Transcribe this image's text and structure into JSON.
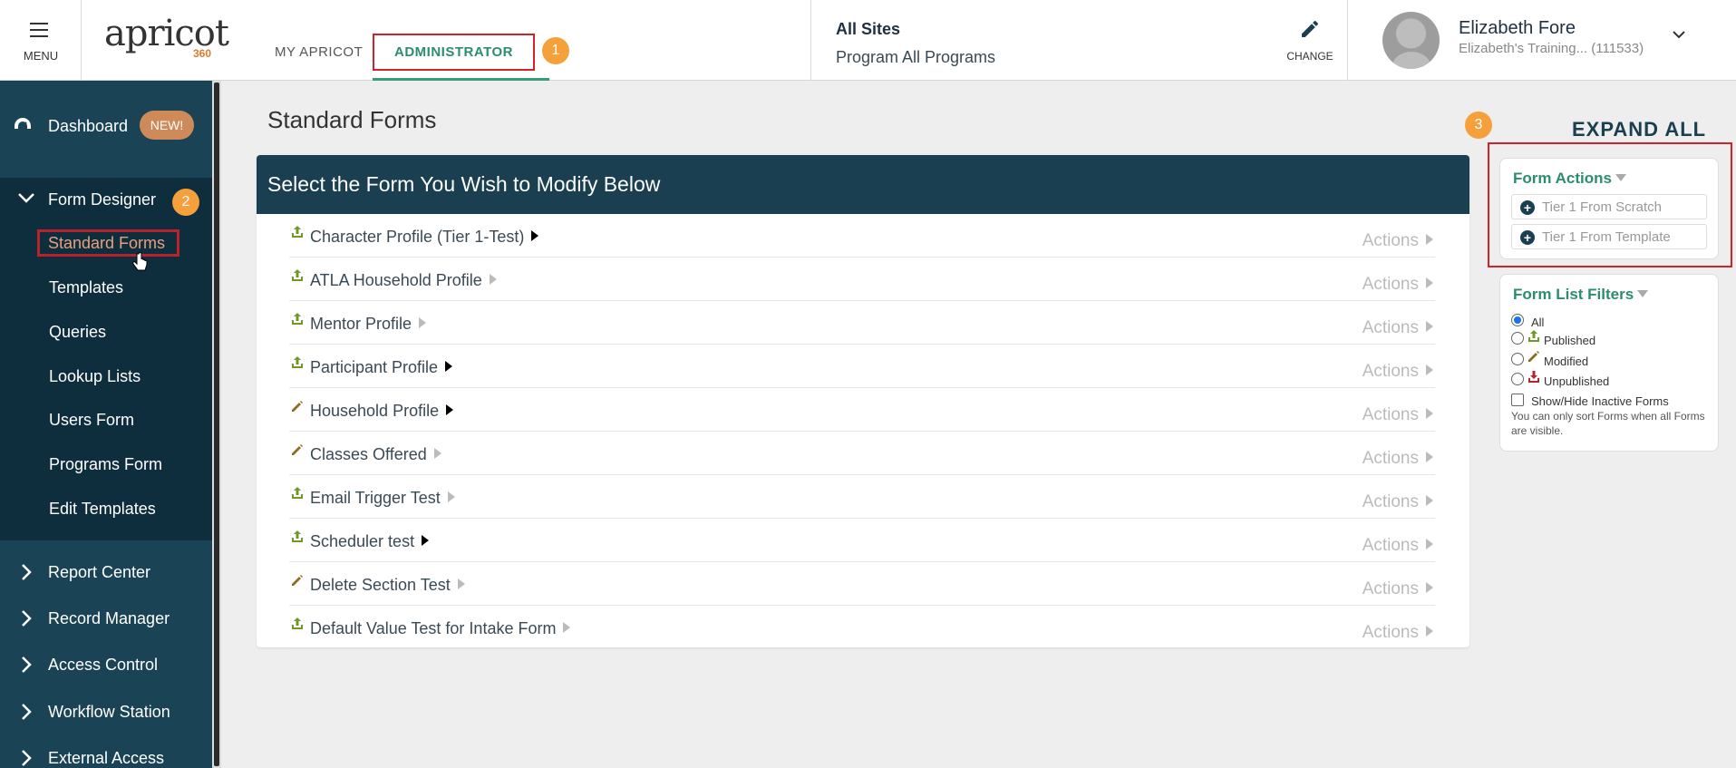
{
  "header": {
    "menu_label": "MENU",
    "logo_text": "apricot",
    "logo_sub": "360",
    "tabs": [
      {
        "label": "MY APRICOT"
      },
      {
        "label": "ADMINISTRATOR"
      }
    ],
    "site": {
      "name": "All Sites",
      "program": "Program All Programs"
    },
    "change_label": "CHANGE",
    "user": {
      "name": "Elizabeth Fore",
      "org": "Elizabeth's Training...  (111533)"
    }
  },
  "badges": [
    "1",
    "2",
    "3"
  ],
  "sidebar": {
    "dashboard": "Dashboard",
    "new_badge": "NEW!",
    "form_designer": "Form Designer",
    "form_designer_items": [
      "Standard Forms",
      "Templates",
      "Queries",
      "Lookup Lists",
      "Users Form",
      "Programs Form",
      "Edit Templates"
    ],
    "sections": [
      "Report Center",
      "Record Manager",
      "Access Control",
      "Workflow Station",
      "External Access"
    ]
  },
  "main": {
    "page_title": "Standard Forms",
    "panel_title": "Select the Form You Wish to Modify Below",
    "actions_label": "Actions",
    "forms": [
      {
        "name": "Character Profile (Tier 1-Test)",
        "status": "published",
        "expandable": true
      },
      {
        "name": "ATLA Household Profile",
        "status": "published",
        "expandable": false
      },
      {
        "name": "Mentor Profile",
        "status": "published",
        "expandable": false
      },
      {
        "name": "Participant Profile",
        "status": "published",
        "expandable": true
      },
      {
        "name": "Household Profile",
        "status": "modified",
        "expandable": true
      },
      {
        "name": "Classes Offered",
        "status": "modified",
        "expandable": false
      },
      {
        "name": "Email Trigger Test",
        "status": "published",
        "expandable": false
      },
      {
        "name": "Scheduler test",
        "status": "published",
        "expandable": true
      },
      {
        "name": "Delete Section Test",
        "status": "modified",
        "expandable": false
      },
      {
        "name": "Default Value Test for Intake Form",
        "status": "published",
        "expandable": false
      }
    ]
  },
  "right": {
    "expand_all": "EXPAND ALL",
    "form_actions_title": "Form Actions",
    "form_actions": [
      "Tier 1 From Scratch",
      "Tier 1 From Template"
    ],
    "filters_title": "Form List Filters",
    "filters": [
      "All",
      "Published",
      "Modified",
      "Unpublished"
    ],
    "selected_filter": "All",
    "inactive_label": "Show/Hide Inactive Forms",
    "note": "You can only sort Forms when all Forms are visible."
  },
  "colors": {
    "nav_bg": "#1a4456",
    "panel_head": "#1a3f50",
    "accent_green": "#2c8c6e",
    "badge_orange": "#f5a03a",
    "highlight_red": "#d0232b"
  }
}
